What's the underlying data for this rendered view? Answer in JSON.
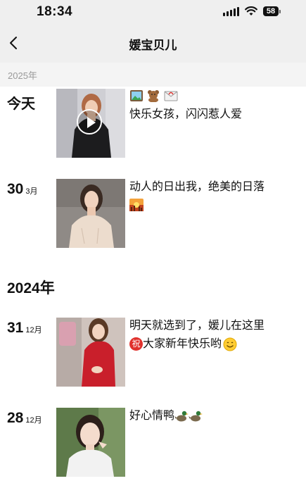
{
  "status_bar": {
    "time": "18:34",
    "battery": "58"
  },
  "nav": {
    "title": "媛宝贝儿"
  },
  "section_2025": {
    "year": "2025年"
  },
  "posts_2025": [
    {
      "day": "今天",
      "month": "",
      "text": "快乐女孩，闪闪惹人爱",
      "emojis": [
        "picture-emoji",
        "teddy-bear-emoji",
        "envelope-emoji"
      ],
      "media": "video"
    },
    {
      "day": "30",
      "month": "3月",
      "text": "动人的日出我，绝美的日落",
      "emojis": [
        "sunset-emoji"
      ],
      "media": "photo"
    }
  ],
  "section_2024": {
    "year": "2024年"
  },
  "posts_2024": [
    {
      "day": "31",
      "month": "12月",
      "text_line1": "明天就选到了，媛儿在这里",
      "badge": "祝",
      "text_line2": "大家新年快乐哟",
      "emojis": [
        "smile-emoji"
      ],
      "media": "photo"
    },
    {
      "day": "28",
      "month": "12月",
      "text": "好心情鸭",
      "emojis": [
        "duck-emoji",
        "duck-emoji"
      ],
      "media": "photo"
    }
  ],
  "colors": {
    "bar_bg": "#efefef",
    "year_header_bg": "#f4f4f4",
    "year_header_text": "#9a9a9a",
    "badge_red": "#e0312c"
  }
}
